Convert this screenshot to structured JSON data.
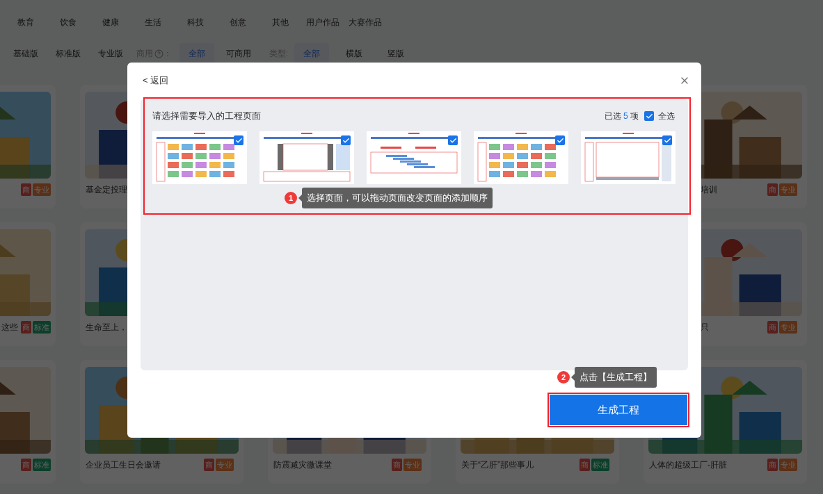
{
  "category_tabs": [
    {
      "label": "教育",
      "selected": false
    },
    {
      "label": "饮食",
      "selected": false
    },
    {
      "label": "健康",
      "selected": false
    },
    {
      "label": "生活",
      "selected": false
    },
    {
      "label": "科技",
      "selected": false
    },
    {
      "label": "创意",
      "selected": false
    },
    {
      "label": "其他",
      "selected": false
    },
    {
      "label": "用户作品",
      "selected": false
    },
    {
      "label": "大赛作品",
      "selected": false
    }
  ],
  "filters": [
    {
      "kind": "option",
      "label": "基础版",
      "selected": false
    },
    {
      "kind": "option",
      "label": "标准版",
      "selected": false
    },
    {
      "kind": "option",
      "label": "专业版",
      "selected": false
    },
    {
      "kind": "label",
      "label": "商用",
      "help": true,
      "colon": "："
    },
    {
      "kind": "option",
      "label": "全部",
      "selected": true
    },
    {
      "kind": "option",
      "label": "可商用",
      "selected": false
    },
    {
      "kind": "label",
      "label": "类型:",
      "help": false
    },
    {
      "kind": "option",
      "label": "全部",
      "selected": true
    },
    {
      "kind": "option",
      "label": "横版",
      "selected": false
    },
    {
      "kind": "option",
      "label": "竖版",
      "selected": false
    }
  ],
  "card_rows": [
    [
      {
        "tags": [
          {
            "label": "商",
            "kind": "commercial"
          },
          {
            "label": "专业",
            "kind": "pro"
          }
        ]
      },
      {
        "title": "基金定投理"
      },
      null,
      null,
      {
        "title": "培训",
        "tags": [
          {
            "label": "商",
            "kind": "commercial"
          },
          {
            "label": "专业",
            "kind": "pro"
          }
        ]
      }
    ],
    [
      {
        "title": "这些",
        "tags": [
          {
            "label": "商",
            "kind": "commercial"
          },
          {
            "label": "标准",
            "kind": "standard"
          }
        ]
      },
      {
        "title": "生命至上，"
      },
      null,
      null,
      {
        "title": "只",
        "tags": [
          {
            "label": "商",
            "kind": "commercial"
          },
          {
            "label": "专业",
            "kind": "pro"
          }
        ]
      }
    ],
    [
      {
        "tags": [
          {
            "label": "商",
            "kind": "commercial"
          },
          {
            "label": "标准",
            "kind": "standard"
          }
        ]
      },
      {
        "title": "企业员工生日会邀请",
        "tags": [
          {
            "label": "商",
            "kind": "commercial"
          },
          {
            "label": "专业",
            "kind": "pro"
          }
        ]
      },
      {
        "title": "防震减灾微课堂",
        "tags": [
          {
            "label": "商",
            "kind": "commercial"
          },
          {
            "label": "专业",
            "kind": "pro"
          }
        ]
      },
      {
        "title": "关于“乙肝”那些事儿",
        "tags": [
          {
            "label": "商",
            "kind": "commercial"
          },
          {
            "label": "标准",
            "kind": "standard"
          }
        ]
      },
      {
        "title": "人体的超级工厂-肝脏",
        "tags": [
          {
            "label": "商",
            "kind": "commercial"
          },
          {
            "label": "专业",
            "kind": "pro"
          }
        ]
      }
    ]
  ],
  "modal": {
    "back_link": "< 返回",
    "panel": {
      "title": "请选择需要导入的工程页面",
      "highlighted": true,
      "count_prefix": "已选",
      "count": "5",
      "count_suffix": "项",
      "select_all": {
        "label": "全选",
        "checked": true
      },
      "pages": [
        {
          "checked": true
        },
        {
          "checked": true
        },
        {
          "checked": true
        },
        {
          "checked": true
        },
        {
          "checked": true
        }
      ]
    },
    "hints": [
      {
        "number": "1",
        "text": "选择页面，可以拖动页面改变页面的添加顺序"
      },
      {
        "number": "2",
        "text": "点击【生成工程】"
      }
    ],
    "generate_button": {
      "label": "生成工程",
      "highlighted": true
    }
  }
}
